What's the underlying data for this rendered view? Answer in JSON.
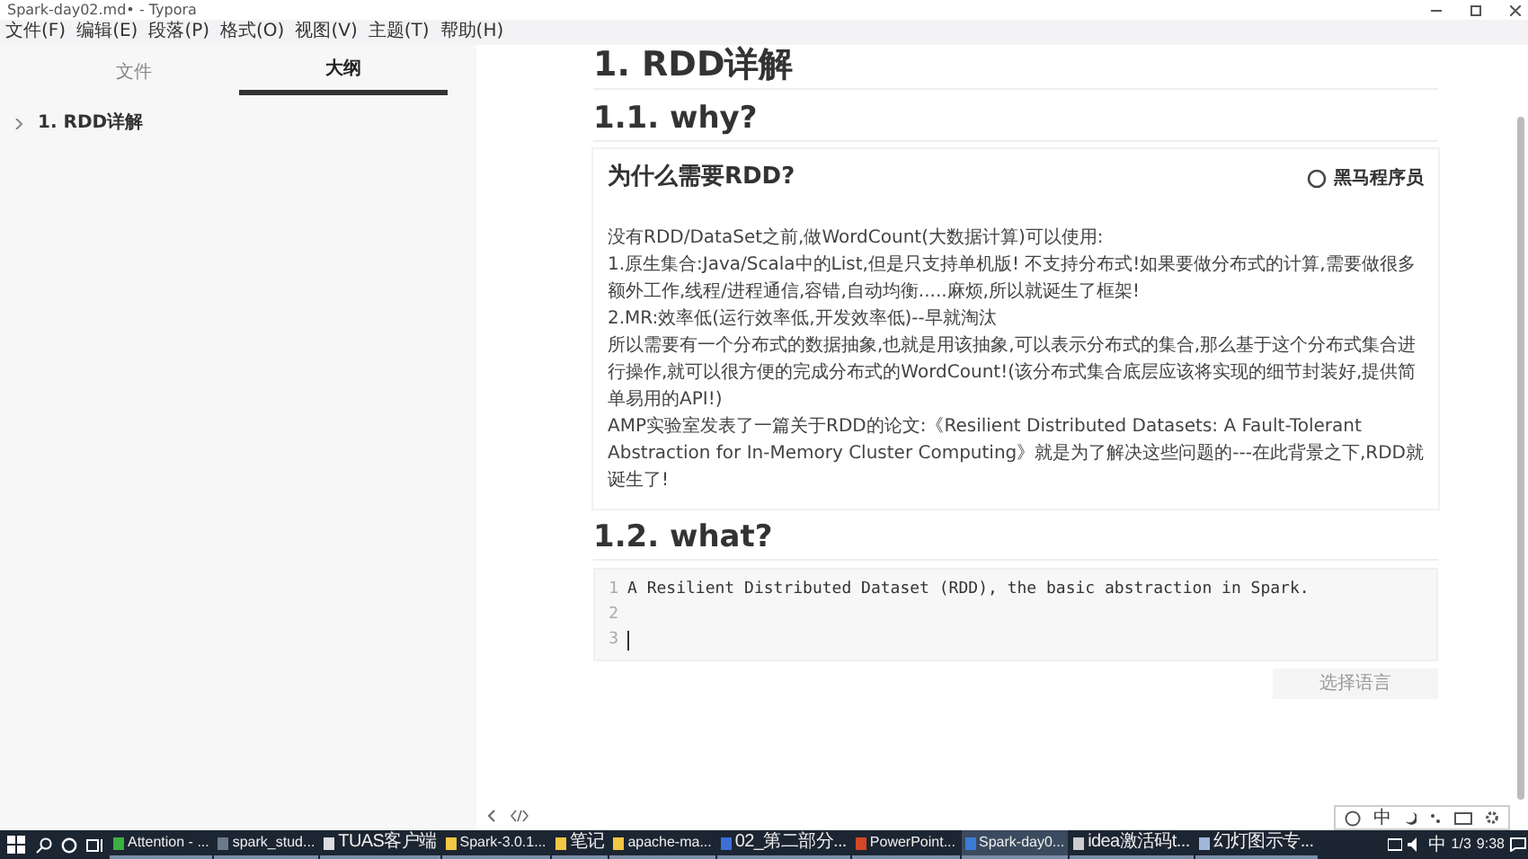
{
  "window": {
    "title": "Spark-day02.md• - Typora"
  },
  "menu": [
    "文件(F)",
    "编辑(E)",
    "段落(P)",
    "格式(O)",
    "视图(V)",
    "主题(T)",
    "帮助(H)"
  ],
  "sidebar": {
    "tabs": [
      {
        "label": "文件",
        "selected": false
      },
      {
        "label": "大纲",
        "selected": true
      }
    ],
    "outline": [
      {
        "label": "1. RDD详解",
        "expanded": false
      }
    ]
  },
  "document": {
    "title": "1. RDD详解",
    "sections": [
      {
        "heading": "1.1. why?",
        "kind": "image",
        "image": {
          "title": "为什么需要RDD?",
          "logo": "黑马程序员",
          "paragraphs": [
            "没有RDD/DataSet之前,做WordCount(大数据计算)可以使用:",
            "1.原生集合:Java/Scala中的List,但是只支持单机版! 不支持分布式!如果要做分布式的计算,需要做很多额外工作,线程/进程通信,容错,自动均衡.....麻烦,所以就诞生了框架!",
            "2.MR:效率低(运行效率低,开发效率低)--早就淘汰",
            "所以需要有一个分布式的数据抽象,也就是用该抽象,可以表示分布式的集合,那么基于这个分布式集合进行操作,就可以很方便的完成分布式的WordCount!(该分布式集合底层应该将实现的细节封装好,提供简单易用的API!)",
            "AMP实验室发表了一篇关于RDD的论文:《Resilient Distributed Datasets: A Fault-Tolerant Abstraction for In-Memory Cluster Computing》就是为了解决这些问题的---在此背景之下,RDD就诞生了!"
          ]
        }
      },
      {
        "heading": "1.2. what?",
        "kind": "code",
        "code": {
          "lines": [
            {
              "number": "1",
              "text": "A Resilient Distributed Dataset (RDD), the basic abstraction in Spark.",
              "caret": false
            },
            {
              "number": "2",
              "caret": false
            },
            {
              "number": "3",
              "caret": true
            }
          ],
          "language_button": "选择语言"
        }
      }
    ]
  },
  "ime_bar": {
    "mode": "中"
  },
  "taskbar": {
    "apps": [
      {
        "label": "Attention - ...",
        "color": "#3cb043",
        "selected": false
      },
      {
        "label": "spark_stud...",
        "color": "#6a7a8c",
        "selected": false
      },
      {
        "label": "TUAS客户端",
        "color": "#dddddd",
        "selected": false
      },
      {
        "label": "Spark-3.0.1...",
        "color": "#f2c744",
        "selected": false
      },
      {
        "label": "笔记",
        "color": "#f2c744",
        "selected": false
      },
      {
        "label": "apache-ma...",
        "color": "#f2c744",
        "selected": false
      },
      {
        "label": "02_第二部分...",
        "color": "#3c6fd6",
        "selected": false
      },
      {
        "label": "PowerPoint...",
        "color": "#d24726",
        "selected": false
      },
      {
        "label": "Spark-day0...",
        "color": "#3b7bd6",
        "selected": true
      },
      {
        "label": "idea激活码t...",
        "color": "#cccccc",
        "selected": false
      },
      {
        "label": "幻灯图示专...",
        "color": "#9fb7d9",
        "selected": false
      }
    ],
    "tray": {
      "input": "中",
      "date": "1/3",
      "time": "9:38"
    }
  }
}
